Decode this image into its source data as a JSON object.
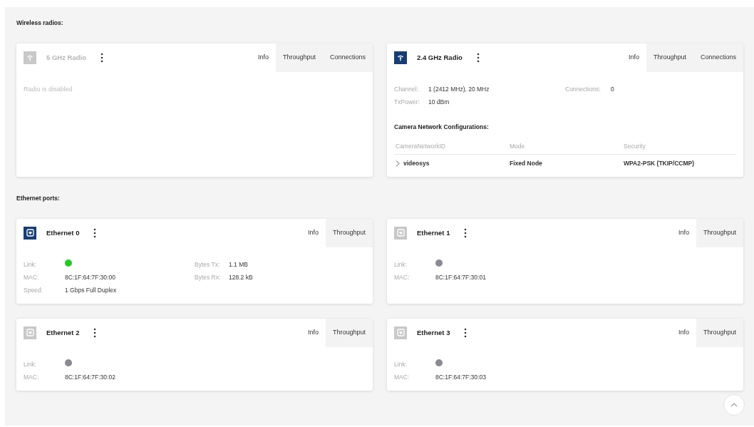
{
  "sections": [
    {
      "heading": "Wireless radios:",
      "cards": [
        {
          "title": "5 GHz Radio",
          "kind": "radio",
          "active": false,
          "disabled": true,
          "tabs": [
            {
              "label": "Info",
              "selected": true
            },
            {
              "label": "Throughput",
              "selected": false
            },
            {
              "label": "Connections",
              "selected": false
            }
          ],
          "message": "Radio is disabled"
        },
        {
          "title": "2.4 GHz Radio",
          "kind": "radio",
          "active": true,
          "disabled": false,
          "tabs": [
            {
              "label": "Info",
              "selected": true
            },
            {
              "label": "Throughput",
              "selected": false
            },
            {
              "label": "Connections",
              "selected": false
            }
          ],
          "columns": [
            [
              {
                "label": "Channel:",
                "value": "1 (2412 MHz), 20 MHz"
              },
              {
                "label": "TxPower:",
                "value": "10 dBm"
              }
            ],
            [
              {
                "label": "Connections:",
                "value": "0"
              }
            ]
          ],
          "config": {
            "title": "Camera Network Configurations:",
            "columns": [
              "CameraNetworkID",
              "Mode",
              "Security"
            ],
            "rows": [
              {
                "expanded": false,
                "cells": [
                  "videosys",
                  "Fixed Node",
                  "WPA2-PSK (TKIP/CCMP)"
                ]
              }
            ]
          }
        }
      ]
    },
    {
      "heading": "Ethernet ports:",
      "cards": [
        {
          "title": "Ethernet 0",
          "kind": "ethernet",
          "active": true,
          "disabled": false,
          "tabs": [
            {
              "label": "Info",
              "selected": true
            },
            {
              "label": "Throughput",
              "selected": false
            }
          ],
          "columns": [
            [
              {
                "label": "Link:",
                "color": "#22cc22"
              },
              {
                "label": "MAC:",
                "value": "8C:1F:64:7F:30:00"
              },
              {
                "label": "Speed:",
                "value": "1 Gbps Full Duplex"
              }
            ],
            [
              {
                "label": "Bytes Tx:",
                "value": "1.1 MB"
              },
              {
                "label": "Bytes Rx:",
                "value": "128.2 kB"
              }
            ]
          ]
        },
        {
          "title": "Ethernet 1",
          "kind": "ethernet",
          "active": false,
          "disabled": false,
          "tabs": [
            {
              "label": "Info",
              "selected": true
            },
            {
              "label": "Throughput",
              "selected": false
            }
          ],
          "columns": [
            [
              {
                "label": "Link:",
                "color": "#8a8a92"
              },
              {
                "label": "MAC:",
                "value": "8C:1F:64:7F:30:01"
              }
            ]
          ]
        },
        {
          "title": "Ethernet 2",
          "kind": "ethernet",
          "active": false,
          "disabled": false,
          "tabs": [
            {
              "label": "Info",
              "selected": true
            },
            {
              "label": "Throughput",
              "selected": false
            }
          ],
          "columns": [
            [
              {
                "label": "Link:",
                "color": "#8a8a92"
              },
              {
                "label": "MAC:",
                "value": "8C:1F:64:7F:30:02"
              }
            ]
          ]
        },
        {
          "title": "Ethernet 3",
          "kind": "ethernet",
          "active": false,
          "disabled": false,
          "tabs": [
            {
              "label": "Info",
              "selected": true
            },
            {
              "label": "Throughput",
              "selected": false
            }
          ],
          "columns": [
            [
              {
                "label": "Link:",
                "color": "#8a8a92"
              },
              {
                "label": "MAC:",
                "value": "8C:1F:64:7F:30:03"
              }
            ]
          ]
        }
      ]
    }
  ]
}
